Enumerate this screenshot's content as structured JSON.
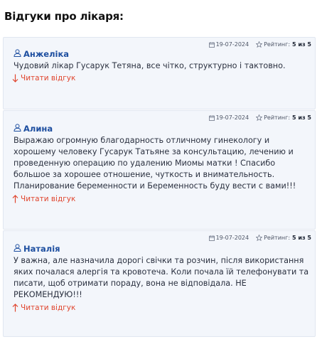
{
  "heading": "Відгуки про лікаря:",
  "reviews": [
    {
      "date": "19-07-2024",
      "rating_label": "Рейтинг:",
      "rating_value": "5 из 5",
      "author": "Анжеліка",
      "text": "Чудовий лікар Гусарук Тетяна, все чітко, структурно і тактовно.",
      "toggle_label": "Читати відгук",
      "toggle_icon": "arrow-down-icon"
    },
    {
      "date": "19-07-2024",
      "rating_label": "Рейтинг:",
      "rating_value": "5 из 5",
      "author": "Алина",
      "text": "Выражаю огромную благодарность отличному гинекологу и хорошему человеку Гусарук Татьяне за консультацию, лечению и проведенную операцию по удалению Миомы матки ! Спасибо большое за хорошее отношение, чуткость и внимательность. Планирование беременности и Беременность буду вести с вами!!!",
      "toggle_label": "Читати відгук",
      "toggle_icon": "arrow-up-icon"
    },
    {
      "date": "19-07-2024",
      "rating_label": "Рейтинг:",
      "rating_value": "5 из 5",
      "author": "Наталія",
      "text": "У важна, але назначила дорогі свічки та розчин, після використання яких почалася алергія та кровотеча. Коли почала їй телефонувати та писати, щоб отримати пораду, вона не відповідала. НЕ РЕКОМЕНДУЮ!!!",
      "toggle_label": "Читати відгук",
      "toggle_icon": "arrow-up-icon"
    }
  ],
  "colors": {
    "author": "#1e4fa0",
    "toggle": "#e0452e",
    "card_bg": "#f3f6fb"
  }
}
